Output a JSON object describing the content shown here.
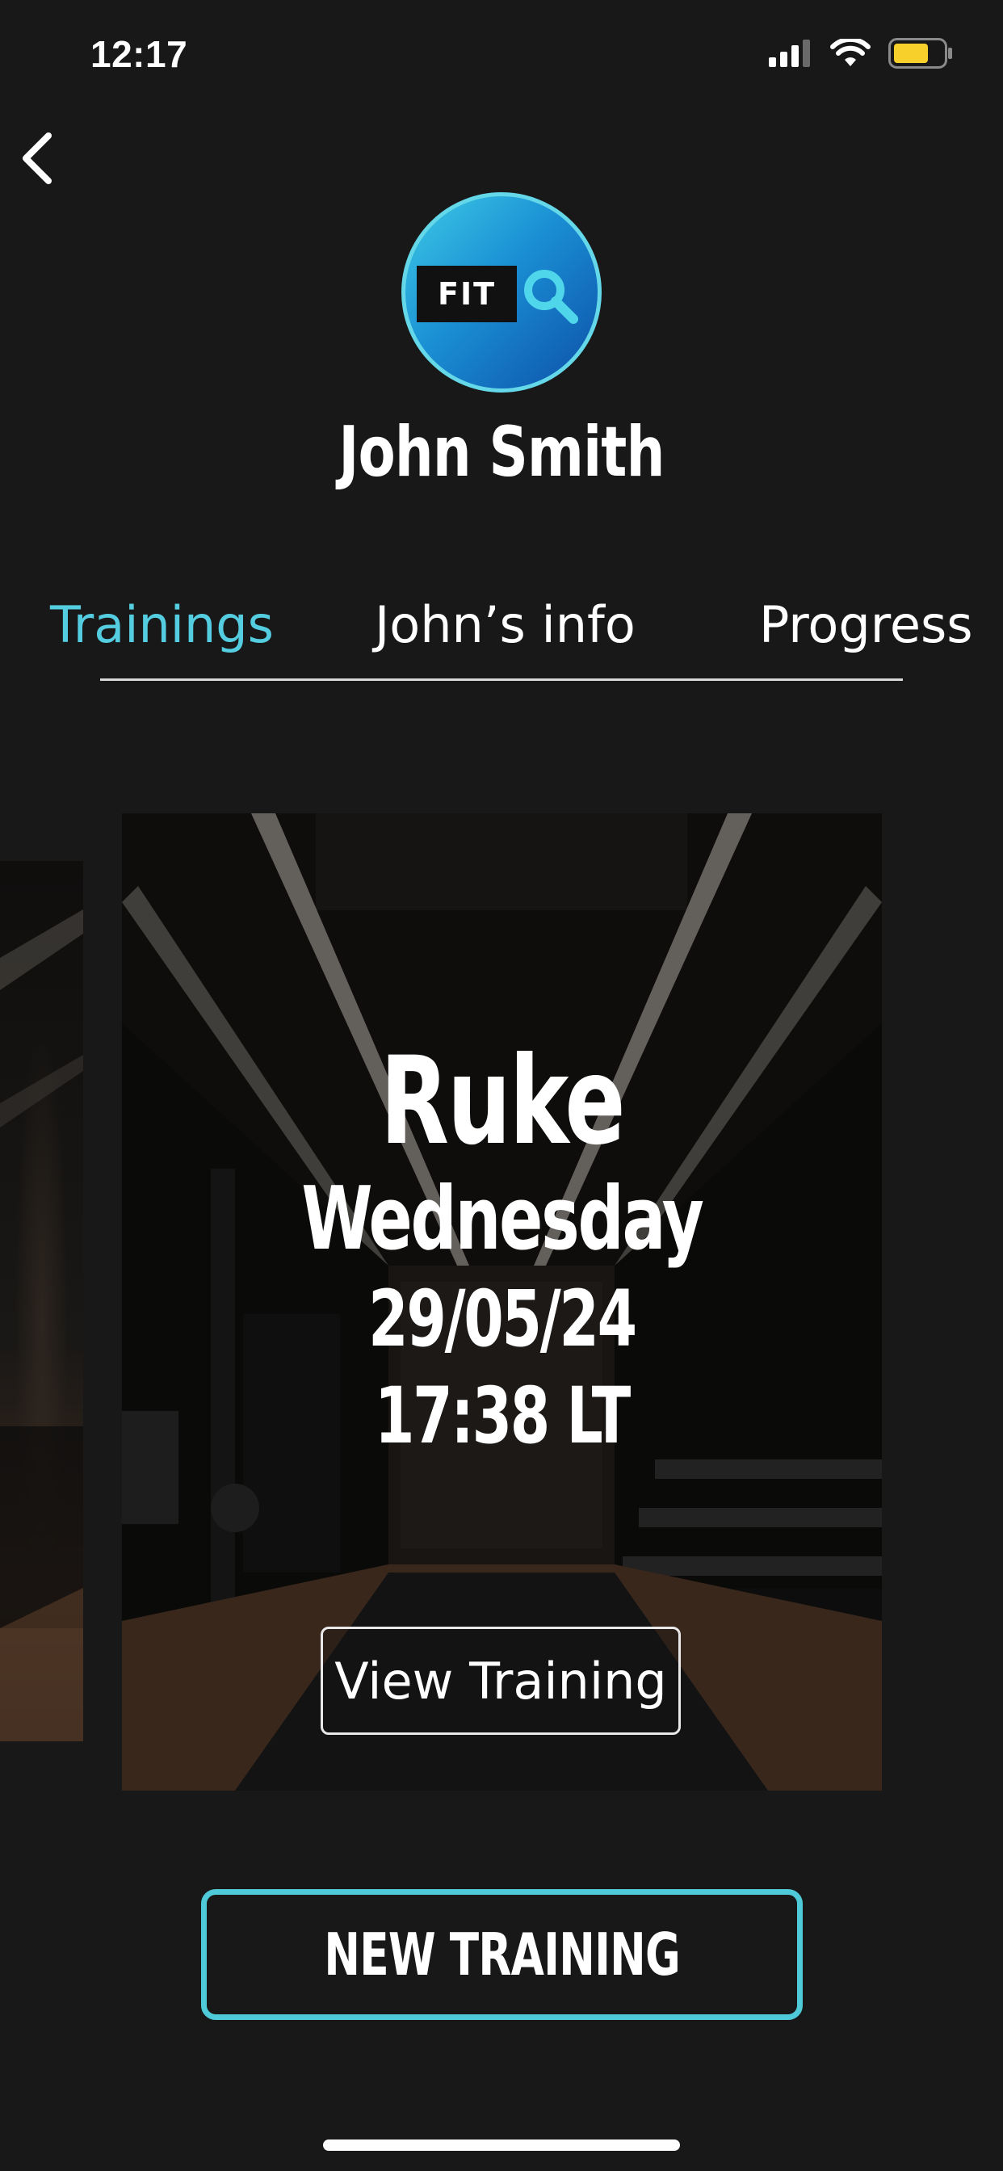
{
  "status_bar": {
    "time": "12:17",
    "icons": [
      "signal-icon",
      "wifi-icon",
      "battery-icon"
    ],
    "battery_color": "#f7d02c"
  },
  "header": {
    "back_icon": "chevron-left-icon",
    "avatar_logo_text": "FIT",
    "user_name": "John Smith"
  },
  "tabs": [
    {
      "label": "Trainings",
      "active": true
    },
    {
      "label": "John’s info",
      "active": false
    },
    {
      "label": "Progress",
      "active": false
    }
  ],
  "training_card": {
    "name": "Ruke",
    "day": "Wednesday",
    "date": "29/05/24",
    "time": "17:38 LT",
    "button_label": "View Training"
  },
  "actions": {
    "new_training_label": "NEW TRAINING"
  },
  "colors": {
    "accent": "#55cde0",
    "background": "#181818",
    "text": "#ffffff"
  }
}
